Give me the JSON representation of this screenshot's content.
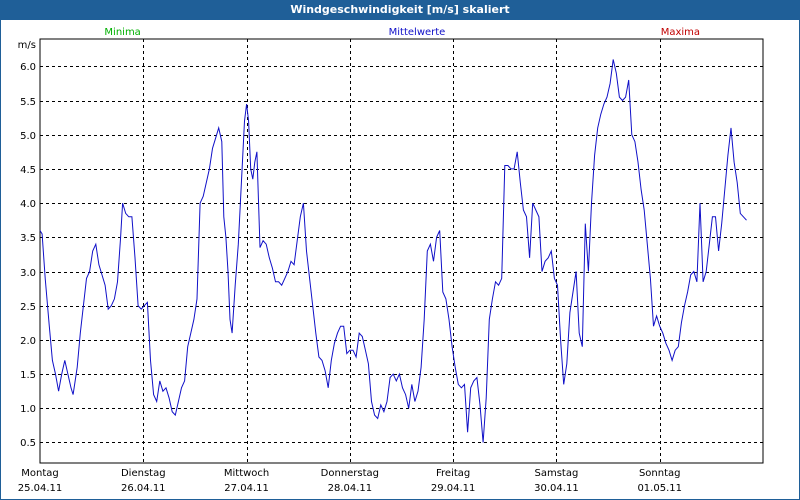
{
  "window": {
    "title": "Windgeschwindigkeit [m/s] skaliert"
  },
  "chart_data": {
    "type": "line",
    "title": "Windgeschwindigkeit [m/s] skaliert",
    "ylabel": "m/s",
    "ylim": [
      0.2,
      6.4
    ],
    "yticks": [
      "0.5",
      "1.0",
      "1.5",
      "2.0",
      "2.5",
      "3.0",
      "3.5",
      "4.0",
      "4.5",
      "5.0",
      "5.5",
      "6.0"
    ],
    "grid": true,
    "legend": [
      {
        "name": "Minima",
        "color": "#00b000"
      },
      {
        "name": "Mittelwerte",
        "color": "#1010c8"
      },
      {
        "name": "Maxima",
        "color": "#c00000"
      }
    ],
    "days": [
      {
        "weekday": "Montag",
        "date": "25.04.11"
      },
      {
        "weekday": "Dienstag",
        "date": "26.04.11"
      },
      {
        "weekday": "Mittwoch",
        "date": "27.04.11"
      },
      {
        "weekday": "Donnerstag",
        "date": "28.04.11"
      },
      {
        "weekday": "Freitag",
        "date": "29.04.11"
      },
      {
        "weekday": "Samstag",
        "date": "30.04.11"
      },
      {
        "weekday": "Sonntag",
        "date": "01.05.11"
      }
    ],
    "series": [
      {
        "name": "Mittelwerte",
        "color": "#1010c8",
        "points": [
          [
            0.0,
            3.6
          ],
          [
            0.02,
            3.55
          ],
          [
            0.05,
            2.9
          ],
          [
            0.09,
            2.2
          ],
          [
            0.12,
            1.7
          ],
          [
            0.15,
            1.5
          ],
          [
            0.18,
            1.25
          ],
          [
            0.21,
            1.5
          ],
          [
            0.24,
            1.7
          ],
          [
            0.27,
            1.5
          ],
          [
            0.3,
            1.3
          ],
          [
            0.32,
            1.2
          ],
          [
            0.36,
            1.6
          ],
          [
            0.39,
            2.1
          ],
          [
            0.42,
            2.5
          ],
          [
            0.45,
            2.9
          ],
          [
            0.48,
            3.0
          ],
          [
            0.51,
            3.3
          ],
          [
            0.54,
            3.4
          ],
          [
            0.57,
            3.1
          ],
          [
            0.6,
            2.95
          ],
          [
            0.63,
            2.8
          ],
          [
            0.66,
            2.45
          ],
          [
            0.69,
            2.5
          ],
          [
            0.72,
            2.6
          ],
          [
            0.75,
            2.85
          ],
          [
            0.78,
            3.5
          ],
          [
            0.8,
            4.0
          ],
          [
            0.83,
            3.85
          ],
          [
            0.86,
            3.8
          ],
          [
            0.89,
            3.8
          ],
          [
            0.92,
            3.2
          ],
          [
            0.95,
            2.5
          ],
          [
            0.98,
            2.45
          ],
          [
            1.01,
            2.5
          ],
          [
            1.04,
            2.55
          ],
          [
            1.07,
            1.7
          ],
          [
            1.1,
            1.2
          ],
          [
            1.13,
            1.1
          ],
          [
            1.16,
            1.4
          ],
          [
            1.19,
            1.25
          ],
          [
            1.22,
            1.3
          ],
          [
            1.25,
            1.15
          ],
          [
            1.28,
            0.95
          ],
          [
            1.31,
            0.9
          ],
          [
            1.34,
            1.1
          ],
          [
            1.37,
            1.3
          ],
          [
            1.4,
            1.4
          ],
          [
            1.43,
            1.9
          ],
          [
            1.46,
            2.1
          ],
          [
            1.49,
            2.3
          ],
          [
            1.52,
            2.6
          ],
          [
            1.55,
            4.0
          ],
          [
            1.58,
            4.1
          ],
          [
            1.61,
            4.3
          ],
          [
            1.64,
            4.5
          ],
          [
            1.67,
            4.8
          ],
          [
            1.7,
            4.95
          ],
          [
            1.73,
            5.1
          ],
          [
            1.76,
            4.9
          ],
          [
            1.78,
            3.8
          ],
          [
            1.8,
            3.5
          ],
          [
            1.82,
            3.0
          ],
          [
            1.84,
            2.3
          ],
          [
            1.86,
            2.1
          ],
          [
            1.89,
            2.8
          ],
          [
            1.92,
            3.4
          ],
          [
            1.95,
            4.3
          ],
          [
            1.98,
            5.2
          ],
          [
            2.0,
            5.45
          ],
          [
            2.02,
            5.2
          ],
          [
            2.04,
            4.5
          ],
          [
            2.06,
            4.35
          ],
          [
            2.08,
            4.6
          ],
          [
            2.1,
            4.75
          ],
          [
            2.13,
            3.35
          ],
          [
            2.16,
            3.45
          ],
          [
            2.19,
            3.4
          ],
          [
            2.22,
            3.2
          ],
          [
            2.25,
            3.05
          ],
          [
            2.28,
            2.85
          ],
          [
            2.31,
            2.85
          ],
          [
            2.34,
            2.8
          ],
          [
            2.37,
            2.9
          ],
          [
            2.4,
            3.0
          ],
          [
            2.43,
            3.15
          ],
          [
            2.46,
            3.1
          ],
          [
            2.49,
            3.45
          ],
          [
            2.52,
            3.8
          ],
          [
            2.55,
            4.0
          ],
          [
            2.58,
            3.3
          ],
          [
            2.61,
            2.9
          ],
          [
            2.64,
            2.5
          ],
          [
            2.67,
            2.1
          ],
          [
            2.7,
            1.75
          ],
          [
            2.73,
            1.7
          ],
          [
            2.76,
            1.55
          ],
          [
            2.79,
            1.3
          ],
          [
            2.82,
            1.7
          ],
          [
            2.85,
            1.95
          ],
          [
            2.88,
            2.1
          ],
          [
            2.91,
            2.2
          ],
          [
            2.94,
            2.2
          ],
          [
            2.97,
            1.8
          ],
          [
            3.0,
            1.85
          ],
          [
            3.03,
            1.85
          ],
          [
            3.06,
            1.75
          ],
          [
            3.09,
            2.1
          ],
          [
            3.12,
            2.05
          ],
          [
            3.15,
            1.85
          ],
          [
            3.18,
            1.65
          ],
          [
            3.21,
            1.1
          ],
          [
            3.24,
            0.9
          ],
          [
            3.27,
            0.85
          ],
          [
            3.3,
            1.05
          ],
          [
            3.33,
            0.95
          ],
          [
            3.36,
            1.1
          ],
          [
            3.39,
            1.45
          ],
          [
            3.42,
            1.5
          ],
          [
            3.45,
            1.4
          ],
          [
            3.48,
            1.5
          ],
          [
            3.51,
            1.3
          ],
          [
            3.54,
            1.2
          ],
          [
            3.57,
            1.0
          ],
          [
            3.6,
            1.35
          ],
          [
            3.63,
            1.1
          ],
          [
            3.66,
            1.25
          ],
          [
            3.69,
            1.6
          ],
          [
            3.72,
            2.3
          ],
          [
            3.75,
            3.3
          ],
          [
            3.78,
            3.4
          ],
          [
            3.81,
            3.15
          ],
          [
            3.84,
            3.5
          ],
          [
            3.87,
            3.6
          ],
          [
            3.9,
            2.7
          ],
          [
            3.93,
            2.6
          ],
          [
            3.96,
            2.3
          ],
          [
            3.99,
            1.9
          ],
          [
            4.02,
            1.6
          ],
          [
            4.05,
            1.35
          ],
          [
            4.08,
            1.3
          ],
          [
            4.11,
            1.35
          ],
          [
            4.14,
            0.65
          ],
          [
            4.17,
            1.3
          ],
          [
            4.2,
            1.4
          ],
          [
            4.23,
            1.45
          ],
          [
            4.26,
            1.05
          ],
          [
            4.29,
            0.5
          ],
          [
            4.32,
            1.15
          ],
          [
            4.35,
            2.3
          ],
          [
            4.38,
            2.6
          ],
          [
            4.41,
            2.85
          ],
          [
            4.44,
            2.8
          ],
          [
            4.47,
            2.9
          ],
          [
            4.5,
            4.55
          ],
          [
            4.53,
            4.55
          ],
          [
            4.56,
            4.5
          ],
          [
            4.59,
            4.5
          ],
          [
            4.62,
            4.75
          ],
          [
            4.65,
            4.3
          ],
          [
            4.68,
            3.9
          ],
          [
            4.71,
            3.8
          ],
          [
            4.74,
            3.2
          ],
          [
            4.77,
            4.0
          ],
          [
            4.8,
            3.9
          ],
          [
            4.83,
            3.8
          ],
          [
            4.86,
            3.0
          ],
          [
            4.89,
            3.15
          ],
          [
            4.92,
            3.2
          ],
          [
            4.95,
            3.3
          ],
          [
            4.98,
            2.9
          ],
          [
            5.01,
            2.8
          ],
          [
            5.04,
            2.0
          ],
          [
            5.07,
            1.35
          ],
          [
            5.1,
            1.65
          ],
          [
            5.13,
            2.4
          ],
          [
            5.16,
            2.7
          ],
          [
            5.19,
            3.0
          ],
          [
            5.22,
            2.1
          ],
          [
            5.25,
            1.9
          ],
          [
            5.28,
            3.7
          ],
          [
            5.31,
            3.0
          ],
          [
            5.34,
            4.0
          ],
          [
            5.37,
            4.7
          ],
          [
            5.4,
            5.1
          ],
          [
            5.43,
            5.3
          ],
          [
            5.46,
            5.45
          ],
          [
            5.49,
            5.55
          ],
          [
            5.52,
            5.75
          ],
          [
            5.55,
            6.1
          ],
          [
            5.58,
            5.9
          ],
          [
            5.61,
            5.55
          ],
          [
            5.64,
            5.5
          ],
          [
            5.67,
            5.55
          ],
          [
            5.7,
            5.8
          ],
          [
            5.73,
            5.0
          ],
          [
            5.76,
            4.9
          ],
          [
            5.79,
            4.6
          ],
          [
            5.82,
            4.2
          ],
          [
            5.85,
            3.9
          ],
          [
            5.88,
            3.4
          ],
          [
            5.91,
            2.9
          ],
          [
            5.94,
            2.2
          ],
          [
            5.97,
            2.35
          ],
          [
            6.0,
            2.2
          ],
          [
            6.03,
            2.1
          ],
          [
            6.06,
            1.95
          ],
          [
            6.09,
            1.85
          ],
          [
            6.12,
            1.7
          ],
          [
            6.15,
            1.85
          ],
          [
            6.18,
            1.9
          ],
          [
            6.21,
            2.25
          ],
          [
            6.24,
            2.5
          ],
          [
            6.27,
            2.7
          ],
          [
            6.3,
            2.95
          ],
          [
            6.33,
            3.0
          ],
          [
            6.36,
            2.85
          ],
          [
            6.39,
            4.0
          ],
          [
            6.42,
            2.85
          ],
          [
            6.45,
            3.0
          ],
          [
            6.48,
            3.4
          ],
          [
            6.51,
            3.8
          ],
          [
            6.54,
            3.8
          ],
          [
            6.57,
            3.3
          ],
          [
            6.6,
            3.7
          ],
          [
            6.63,
            4.2
          ],
          [
            6.66,
            4.7
          ],
          [
            6.69,
            5.1
          ],
          [
            6.72,
            4.6
          ],
          [
            6.75,
            4.3
          ],
          [
            6.78,
            3.85
          ],
          [
            6.81,
            3.8
          ],
          [
            6.84,
            3.75
          ]
        ]
      }
    ]
  }
}
